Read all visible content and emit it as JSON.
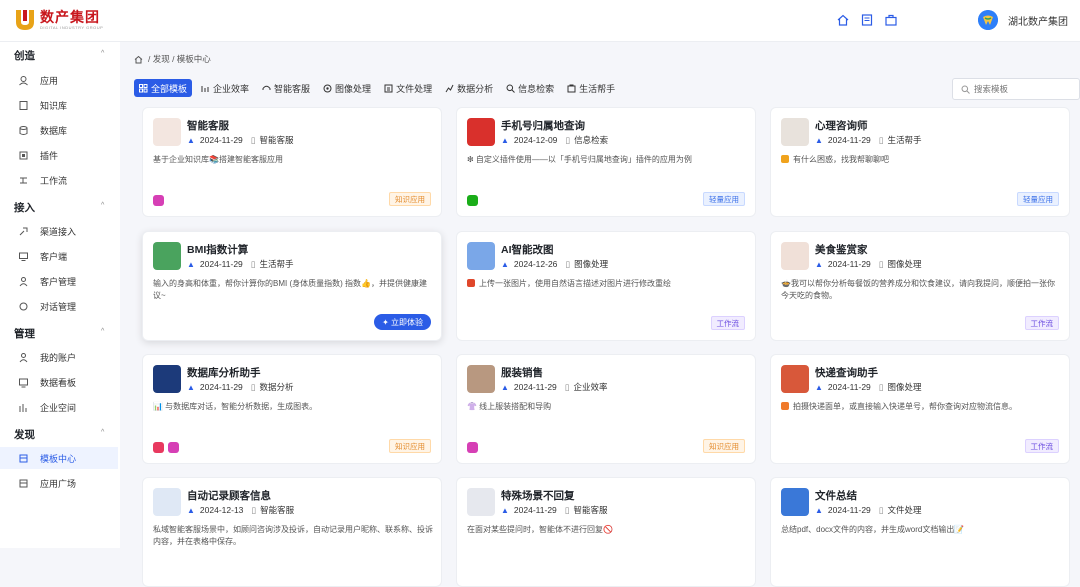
{
  "brand": {
    "name": "数产集团",
    "sub": "DIGITAL INDUSTRY GROUP"
  },
  "user": {
    "name": "湖北数产集团"
  },
  "top_icons": [
    "home-icon",
    "book-icon",
    "briefcase-icon"
  ],
  "sidebar": {
    "sections": [
      {
        "title": "创造",
        "items": [
          {
            "label": "应用",
            "icon": "app-icon"
          },
          {
            "label": "知识库",
            "icon": "knowledge-icon"
          },
          {
            "label": "数据库",
            "icon": "database-icon"
          },
          {
            "label": "插件",
            "icon": "plugin-icon"
          },
          {
            "label": "工作流",
            "icon": "workflow-icon"
          }
        ]
      },
      {
        "title": "接入",
        "items": [
          {
            "label": "渠道接入",
            "icon": "channel-icon"
          },
          {
            "label": "客户端",
            "icon": "client-icon"
          },
          {
            "label": "客户管理",
            "icon": "customer-icon"
          },
          {
            "label": "对话管理",
            "icon": "chat-icon"
          }
        ]
      },
      {
        "title": "管理",
        "items": [
          {
            "label": "我的账户",
            "icon": "user-icon"
          },
          {
            "label": "数据看板",
            "icon": "dashboard-icon"
          },
          {
            "label": "企业空间",
            "icon": "enterprise-icon"
          }
        ]
      },
      {
        "title": "发现",
        "items": [
          {
            "label": "模板中心",
            "icon": "template-icon",
            "active": true
          },
          {
            "label": "应用广场",
            "icon": "store-icon"
          }
        ]
      }
    ]
  },
  "breadcrumb": {
    "text": "/ 发现 / 模板中心"
  },
  "tabs": [
    {
      "label": "全部模板",
      "icon": "grid-icon",
      "active": true
    },
    {
      "label": "企业效率",
      "icon": "bar-icon"
    },
    {
      "label": "智能客服",
      "icon": "headset-icon"
    },
    {
      "label": "图像处理",
      "icon": "image-icon"
    },
    {
      "label": "文件处理",
      "icon": "file-icon"
    },
    {
      "label": "数据分析",
      "icon": "analytics-icon"
    },
    {
      "label": "信息检索",
      "icon": "search-icon"
    },
    {
      "label": "生活帮手",
      "icon": "life-icon"
    }
  ],
  "search": {
    "placeholder": "搜索模板"
  },
  "cards": [
    {
      "title": "智能客服",
      "date": "2024-11-29",
      "category": "智能客服",
      "desc": "基于企业知识库📚搭建智能客服应用",
      "badge": "知识应用",
      "badge_type": "zhishi",
      "platforms": [
        "#d63fb5"
      ],
      "thumb": "#f3e6e0"
    },
    {
      "title": "手机号归属地查询",
      "date": "2024-12-09",
      "category": "信息检索",
      "desc": "❇ 自定义插件使用——以「手机号归属地查询」插件的应用为例",
      "badge": "轻量应用",
      "badge_type": "qing",
      "platforms": [
        "#1aad19"
      ],
      "thumb": "#d9302c"
    },
    {
      "title": "心理咨询师",
      "date": "2024-11-29",
      "category": "生活帮手",
      "desc": "有什么困惑，找我帮聊聊吧",
      "badge": "轻量应用",
      "badge_type": "qing",
      "platforms": [],
      "thumb": "#e8e2dc",
      "lead": "#f0a31d"
    },
    {
      "title": "BMI指数计算",
      "date": "2024-11-29",
      "category": "生活帮手",
      "desc": "输入的身高和体重，帮你计算你的BMI (身体质量指数) 指数👍，并提供健康建议~",
      "badge": "",
      "badge_type": "",
      "platforms": [],
      "thumb": "#4aa35e",
      "try": "立即体验"
    },
    {
      "title": "AI智能改图",
      "date": "2024-12-26",
      "category": "图像处理",
      "desc": "上传一张图片，使用自然语言描述对图片进行修改重绘",
      "badge": "工作流",
      "badge_type": "work",
      "platforms": [],
      "thumb": "#7aa7e8",
      "lead": "#e0472b"
    },
    {
      "title": "美食鉴赏家",
      "date": "2024-11-29",
      "category": "图像处理",
      "desc": "🍲我可以帮你分析每餐饭的营养成分和饮食建议，请向我提问，顺便拍一张你今天吃的食物。",
      "badge": "工作流",
      "badge_type": "work",
      "platforms": [],
      "thumb": "#f0e0d8"
    },
    {
      "title": "数据库分析助手",
      "date": "2024-11-29",
      "category": "数据分析",
      "desc": "📊 与数据库对话，智能分析数据，生成图表。",
      "badge": "知识应用",
      "badge_type": "zhishi",
      "platforms": [
        "#e8395f",
        "#d63fb5"
      ],
      "thumb": "#1c3a7a"
    },
    {
      "title": "服装销售",
      "date": "2024-11-29",
      "category": "企业效率",
      "desc": "👚 线上服装搭配和导购",
      "badge": "知识应用",
      "badge_type": "zhishi",
      "platforms": [
        "#d63fb5"
      ],
      "thumb": "#b89880"
    },
    {
      "title": "快递查询助手",
      "date": "2024-11-29",
      "category": "图像处理",
      "desc": "拍摄快递面单，或直接输入快递单号，帮你查询对应物流信息。",
      "badge": "工作流",
      "badge_type": "work",
      "platforms": [],
      "thumb": "#d8583a",
      "lead": "#f07a2a"
    },
    {
      "title": "自动记录顾客信息",
      "date": "2024-12-13",
      "category": "智能客服",
      "desc": "私域智能客服场景中，如顾问咨询涉及投诉，自动记录用户昵称、联系称、投诉内容，并在表格中保存。",
      "badge": "",
      "badge_type": "",
      "platforms": [],
      "thumb": "#dfe8f5"
    },
    {
      "title": "特殊场景不回复",
      "date": "2024-11-29",
      "category": "智能客服",
      "desc": "在面对某些提问时，智能体不进行回复🚫",
      "badge": "",
      "badge_type": "",
      "platforms": [],
      "thumb": "#e6e8ee"
    },
    {
      "title": "文件总结",
      "date": "2024-11-29",
      "category": "文件处理",
      "desc": "总结pdf、docx文件的内容，并生成word文档输出📝",
      "badge": "",
      "badge_type": "",
      "platforms": [],
      "thumb": "#3a78d8"
    }
  ]
}
